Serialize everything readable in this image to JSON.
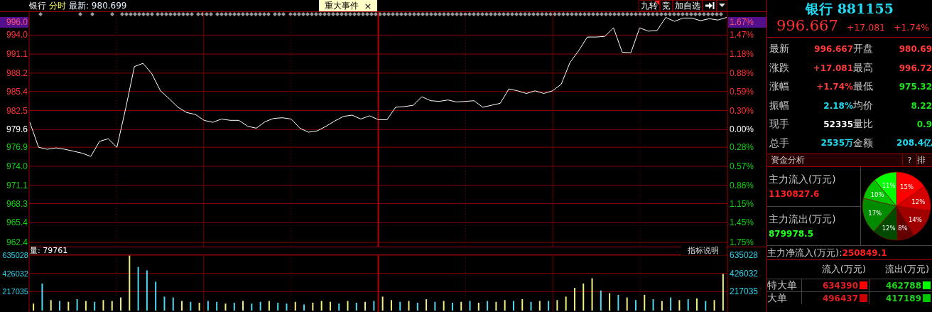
{
  "header": {
    "name": "银行",
    "mode": "分时",
    "latest": "最新: 980.699"
  },
  "event_tab": {
    "label": "重大事件",
    "close": "×"
  },
  "toolbar": [
    {
      "kind": "text",
      "label": "九转",
      "flagged": true
    },
    {
      "kind": "text",
      "label": "竞",
      "flagged": false
    },
    {
      "kind": "text",
      "label": "加自选",
      "flagged": false
    },
    {
      "kind": "icon"
    },
    {
      "kind": "caret"
    }
  ],
  "price_chart": {
    "marker": {
      "price": "996.0",
      "pct": "1.67%"
    },
    "pct_ticks": [
      {
        "label": "1.47%",
        "color": "#ff3232"
      },
      {
        "label": "1.18%",
        "color": "#ff3232"
      },
      {
        "label": "0.88%",
        "color": "#ff3232"
      },
      {
        "label": "0.59%",
        "color": "#ff3232"
      },
      {
        "label": "0.30%",
        "color": "#ff3232"
      },
      {
        "label": "0.00%",
        "color": "#ffffff"
      },
      {
        "label": "0.28%",
        "color": "#10d010"
      },
      {
        "label": "0.57%",
        "color": "#10d010"
      },
      {
        "label": "0.86%",
        "color": "#10d010"
      },
      {
        "label": "1.15%",
        "color": "#10d010"
      },
      {
        "label": "1.45%",
        "color": "#10d010"
      },
      {
        "label": "1.75%",
        "color": "#10d010"
      }
    ],
    "chart_data": {
      "type": "line",
      "grid": true,
      "ylim": [
        962.4,
        997.4
      ],
      "yticks": [
        {
          "value": 994.0,
          "label": "994.0"
        },
        {
          "value": 991.1,
          "label": "991.1"
        },
        {
          "value": 988.2,
          "label": "988.2"
        },
        {
          "value": 985.4,
          "label": "985.4"
        },
        {
          "value": 982.5,
          "label": "982.5"
        },
        {
          "value": 979.6,
          "label": "979.6"
        },
        {
          "value": 976.9,
          "label": "976.9"
        },
        {
          "value": 974.0,
          "label": "974.0"
        },
        {
          "value": 971.1,
          "label": "971.1"
        },
        {
          "value": 968.3,
          "label": "968.3"
        },
        {
          "value": 965.4,
          "label": "965.4"
        },
        {
          "value": 962.4,
          "label": "962.4"
        }
      ],
      "categories": [
        null,
        null,
        null,
        null,
        null,
        null,
        null,
        null,
        null,
        null,
        null,
        null,
        null,
        null,
        null,
        null,
        null,
        null,
        null,
        null,
        null,
        null,
        null,
        null,
        null,
        null,
        null,
        null,
        null,
        null,
        null,
        null,
        null,
        null,
        null,
        null,
        null,
        null,
        null,
        null,
        null,
        null,
        null,
        null,
        null,
        null,
        null,
        null,
        null,
        null,
        null,
        null,
        null,
        null,
        null,
        null,
        null,
        null,
        null,
        null,
        null,
        null,
        null,
        null,
        null,
        null,
        null,
        null,
        null,
        null,
        null,
        null,
        null,
        null,
        null,
        null,
        null,
        null,
        null,
        null,
        null
      ],
      "series": [
        {
          "color": "#ffffff",
          "values": [
            980.7,
            976.9,
            976.6,
            976.8,
            976.6,
            976.3,
            976.0,
            975.5,
            977.8,
            978.2,
            976.9,
            982.8,
            989.2,
            989.7,
            988.1,
            985.5,
            984.3,
            983.0,
            982.2,
            981.9,
            981.0,
            980.7,
            981.2,
            981.0,
            981.0,
            980.1,
            979.8,
            980.8,
            981.3,
            981.4,
            981.2,
            979.8,
            979.2,
            979.4,
            980.1,
            980.9,
            981.6,
            981.8,
            981.2,
            981.7,
            981.1,
            981.1,
            983.0,
            983.1,
            983.3,
            984.6,
            984.0,
            983.9,
            984.1,
            983.8,
            983.9,
            984.0,
            983.0,
            983.3,
            983.6,
            985.8,
            985.5,
            985.1,
            985.5,
            985.1,
            985.5,
            986.5,
            989.8,
            991.6,
            993.7,
            993.7,
            993.8,
            995.1,
            991.4,
            991.3,
            995.1,
            994.6,
            994.7,
            996.7,
            996.1,
            996.6,
            996.6,
            996.2,
            996.5,
            996.3,
            996.7
          ]
        }
      ]
    }
  },
  "volume": {
    "label": "量: 79761",
    "button": "指标说明",
    "right_ticks": [
      "635028",
      "426032",
      "217035"
    ],
    "chart_data": {
      "type": "bar",
      "stacked": true,
      "grid": true,
      "ylim": [
        0,
        635028
      ],
      "yticks": [
        635028,
        426032,
        217035
      ],
      "categories": [
        null,
        null,
        null,
        null,
        null,
        null,
        null,
        null,
        null,
        null,
        null,
        null,
        null,
        null,
        null,
        null,
        null,
        null,
        null,
        null,
        null,
        null,
        null,
        null,
        null,
        null,
        null,
        null,
        null,
        null,
        null,
        null,
        null,
        null,
        null,
        null,
        null,
        null,
        null,
        null,
        null,
        null,
        null,
        null,
        null,
        null,
        null,
        null,
        null,
        null,
        null,
        null,
        null,
        null,
        null,
        null,
        null,
        null,
        null,
        null,
        null,
        null,
        null,
        null,
        null,
        null,
        null,
        null,
        null,
        null,
        null,
        null,
        null,
        null,
        null,
        null,
        null,
        null,
        null,
        null
      ],
      "series": [
        {
          "color": "#f0f080",
          "values": [
            80000,
            null,
            120000,
            null,
            100000,
            null,
            110000,
            null,
            120000,
            110000,
            150000,
            630000,
            null,
            null,
            null,
            null,
            null,
            110000,
            null,
            90000,
            null,
            null,
            80000,
            null,
            110000,
            null,
            null,
            110000,
            null,
            null,
            100000,
            null,
            90000,
            110000,
            100000,
            null,
            110000,
            null,
            100000,
            null,
            160000,
            120000,
            null,
            110000,
            null,
            130000,
            null,
            110000,
            null,
            100000,
            null,
            90000,
            null,
            100000,
            120000,
            null,
            130000,
            null,
            110000,
            null,
            120000,
            160000,
            260000,
            310000,
            370000,
            null,
            200000,
            null,
            150000,
            null,
            180000,
            null,
            110000,
            null,
            120000,
            null,
            140000,
            null,
            120000,
            420000
          ]
        },
        {
          "color": "#50d8f0",
          "values": [
            null,
            310000,
            null,
            110000,
            null,
            130000,
            null,
            100000,
            null,
            null,
            null,
            null,
            500000,
            460000,
            330000,
            160000,
            150000,
            null,
            100000,
            null,
            110000,
            100000,
            null,
            90000,
            null,
            80000,
            100000,
            null,
            90000,
            80000,
            null,
            70000,
            null,
            null,
            null,
            80000,
            null,
            90000,
            null,
            110000,
            null,
            null,
            100000,
            null,
            90000,
            null,
            100000,
            null,
            90000,
            null,
            110000,
            null,
            110000,
            null,
            null,
            110000,
            null,
            100000,
            null,
            110000,
            null,
            null,
            null,
            null,
            null,
            230000,
            null,
            180000,
            null,
            120000,
            null,
            130000,
            null,
            150000,
            null,
            130000,
            null,
            110000,
            null,
            null
          ]
        }
      ]
    }
  },
  "quote": {
    "title": "银行 881155",
    "price": "996.667",
    "change": "+17.081",
    "change_pct": "+1.74%"
  },
  "stats": [
    {
      "label": "最新",
      "value": "996.667",
      "color": "#ff3a3a"
    },
    {
      "label": "开盘",
      "value": "980.69",
      "color": "#ff3a3a"
    },
    {
      "label": "涨跌",
      "value": "+17.081",
      "color": "#ff3a3a"
    },
    {
      "label": "最高",
      "value": "996.72",
      "color": "#ff3a3a"
    },
    {
      "label": "涨幅",
      "value": "+1.74%",
      "color": "#ff3a3a"
    },
    {
      "label": "最低",
      "value": "975.32",
      "color": "#20e020"
    },
    {
      "label": "振幅",
      "value": "2.18%",
      "color": "#20d8f0"
    },
    {
      "label": "均价",
      "value": "8.22",
      "color": "#20e020"
    },
    {
      "label": "现手",
      "value": "52335",
      "color": "#ffffff"
    },
    {
      "label": "量比",
      "value": "0.9",
      "color": "#20e020"
    },
    {
      "label": "总手",
      "value": "2535万",
      "color": "#20d8f0"
    },
    {
      "label": "金额",
      "value": "208.4亿",
      "color": "#20d8f0"
    }
  ],
  "fund": {
    "title": "资金分析",
    "help": "?",
    "rank": "排",
    "inflow_label": "主力流入(万元)",
    "inflow": "1130827.6",
    "outflow_label": "主力流出(万元)",
    "outflow": "879978.5",
    "pie": {
      "chart_data": {
        "type": "pie",
        "values": [
          15,
          12,
          14,
          8,
          12,
          17,
          10,
          11
        ],
        "value_labels": [
          "15%",
          "12%",
          "14%",
          "8%",
          "12%",
          "17%",
          "10%",
          "11%"
        ],
        "colors": [
          "#ff0000",
          "#d40000",
          "#a00000",
          "#640000",
          "#004a00",
          "#008a00",
          "#00c400",
          "#00ff00"
        ]
      }
    },
    "net_label": "主力净流入(万元):",
    "net": "250849.1",
    "columns": [
      "流入(万元)",
      "流出(万元)"
    ],
    "rows": [
      {
        "label": "特大单",
        "inflow": {
          "value": "634390",
          "color": "#ff0000"
        },
        "outflow": {
          "value": "462788",
          "color": "#00ff00"
        }
      },
      {
        "label": "大单",
        "inflow": {
          "value": "496437",
          "color": "#c80000"
        },
        "outflow": {
          "value": "417189",
          "color": "#00c800"
        }
      }
    ]
  }
}
